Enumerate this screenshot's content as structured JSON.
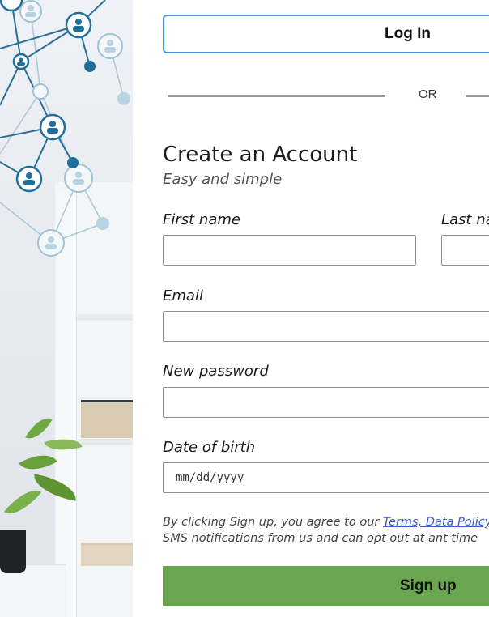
{
  "colors": {
    "login_border": "#4a90d9",
    "signup_bg": "#6aa650",
    "network_node": "#1f6f9a",
    "link": "#3b5bd6"
  },
  "login": {
    "label": "Log In"
  },
  "divider": {
    "text": "OR"
  },
  "form": {
    "title": "Create an Account",
    "subtitle": "Easy and simple",
    "first_name": {
      "label": "First name",
      "value": ""
    },
    "last_name": {
      "label": "Last na"
    },
    "email": {
      "label": "Email",
      "value": ""
    },
    "password": {
      "label": "New password",
      "value": ""
    },
    "dob": {
      "label": "Date of birth",
      "placeholder": "mm/dd/yyyy"
    }
  },
  "terms": {
    "prefix": "By clicking Sign up, you agree to our ",
    "link": "Terms, Data Policy",
    "suffix": "SMS notifications from us and can opt out at ant time"
  },
  "signup": {
    "label": "Sign up"
  },
  "side_image": {
    "icons": [
      "network-node-icon",
      "person-icon",
      "plant-icon"
    ]
  }
}
